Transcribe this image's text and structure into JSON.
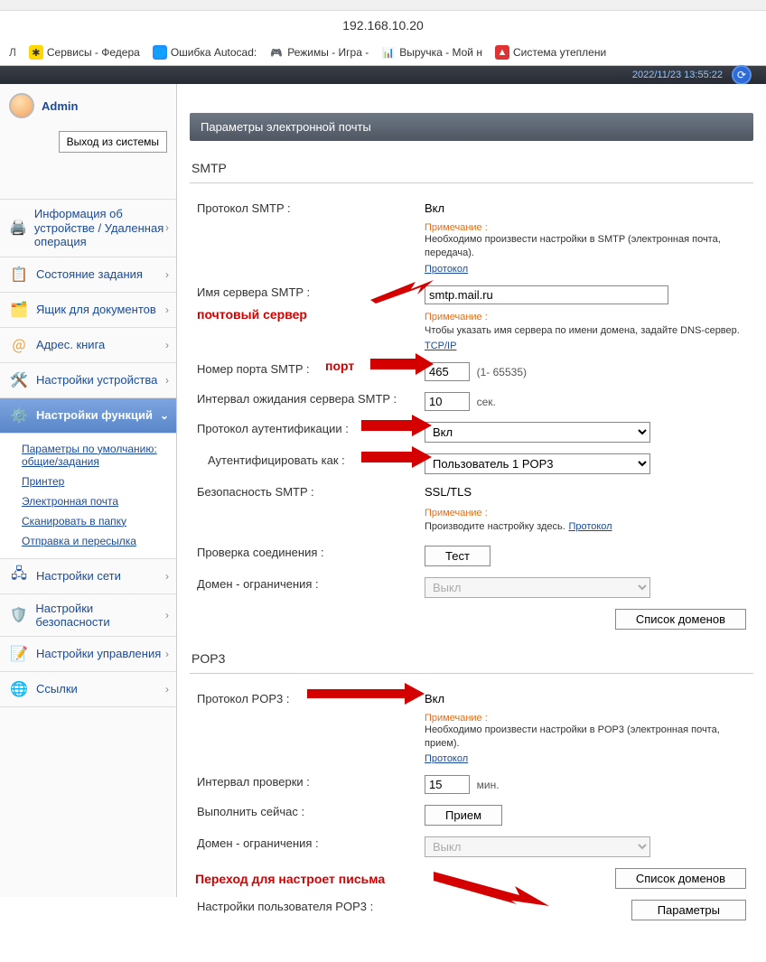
{
  "url": "192.168.10.20",
  "bookmarks": [
    {
      "label": "Сервисы - Федера"
    },
    {
      "label": "Ошибка Autocad:"
    },
    {
      "label": "Режимы - Игра -"
    },
    {
      "label": "Выручка - Мой н"
    },
    {
      "label": "Система утеплени"
    }
  ],
  "bookmark_prefix": "Л",
  "header_timestamp": "2022/11/23 13:55:22",
  "user": {
    "name": "Admin",
    "logout": "Выход из системы"
  },
  "sidebar": {
    "items": [
      {
        "label": "Информация об устройстве / Удаленная операция"
      },
      {
        "label": "Состояние задания"
      },
      {
        "label": "Ящик для документов"
      },
      {
        "label": "Адрес. книга"
      },
      {
        "label": "Настройки устройства"
      },
      {
        "label": "Настройки функций"
      },
      {
        "label": "Настройки сети"
      },
      {
        "label": "Настройки безопасности"
      },
      {
        "label": "Настройки управления"
      },
      {
        "label": "Ссылки"
      }
    ],
    "sub": [
      "Параметры по умолчанию: общие/задания",
      "Принтер",
      "Электронная почта",
      "Сканировать в папку",
      "Отправка и пересылка"
    ]
  },
  "panel_title": "Параметры электронной почты",
  "smtp": {
    "title": "SMTP",
    "protocol_label": "Протокол SMTP :",
    "protocol_value": "Вкл",
    "note1_title": "Примечание :",
    "note1_text": "Необходимо произвести настройки в SMTP (электронная почта, передача).",
    "note1_link": "Протокол",
    "server_label": "Имя сервера SMTP :",
    "server_value": "smtp.mail.ru",
    "note2_title": "Примечание :",
    "note2_text": "Чтобы указать имя сервера по имени домена, задайте DNS-сервер.",
    "note2_link": "TCP/IP",
    "port_label": "Номер порта SMTP :",
    "port_value": "465",
    "port_range": "(1- 65535)",
    "timeout_label": "Интервал ожидания сервера SMTP :",
    "timeout_value": "10",
    "timeout_unit": "сек.",
    "auth_proto_label": "Протокол аутентификации :",
    "auth_proto_value": "Вкл",
    "auth_as_label": "Аутентифицировать как :",
    "auth_as_value": "Пользователь 1 POP3",
    "security_label": "Безопасность SMTP :",
    "security_value": "SSL/TLS",
    "note3_title": "Примечание :",
    "note3_text": "Производите настройку здесь.",
    "note3_link": "Протокол",
    "conn_label": "Проверка соединения :",
    "conn_button": "Тест",
    "domain_label": "Домен - ограничения :",
    "domain_value": "Выкл",
    "domain_list_btn": "Список доменов"
  },
  "pop3": {
    "title": "POP3",
    "protocol_label": "Протокол POP3 :",
    "protocol_value": "Вкл",
    "note1_title": "Примечание :",
    "note1_text": "Необходимо произвести настройки в POP3 (электронная почта, прием).",
    "note1_link": "Протокол",
    "interval_label": "Интервал проверки :",
    "interval_value": "15",
    "interval_unit": "мин.",
    "runnow_label": "Выполнить сейчас :",
    "runnow_button": "Прием",
    "domain_label": "Домен - ограничения :",
    "domain_value": "Выкл",
    "domain_list_btn": "Список доменов",
    "user_label": "Настройки пользователя POP3 :",
    "user_button": "Параметры"
  },
  "annotations": {
    "server": "почтовый сервер",
    "port": "порт",
    "transition": "Переход для настроет письма"
  }
}
